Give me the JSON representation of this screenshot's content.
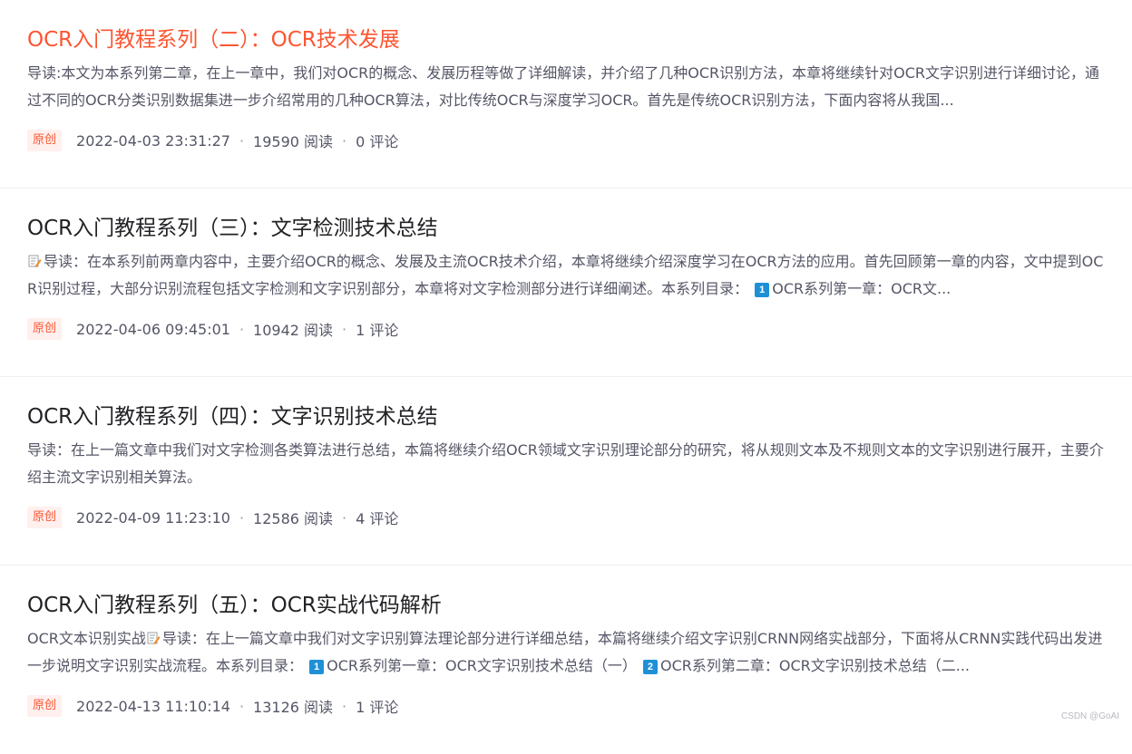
{
  "articles": [
    {
      "title": "OCR入门教程系列（二）：OCR技术发展",
      "summary_prefix": "",
      "summary": "导读:本文为本系列第二章，在上一章中，我们对OCR的概念、发展历程等做了详细解读，并介绍了几种OCR识别方法，本章将继续针对OCR文字识别进行详细讨论，通过不同的OCR分类识别数据集进一步介绍常用的几种OCR算法，对比传统OCR与深度学习OCR。首先是传统OCR识别方法，下面内容将从我国...",
      "tag": "原创",
      "date": "2022-04-03 23:31:27",
      "reads": "19590 阅读",
      "comments": "0 评论"
    },
    {
      "title": "OCR入门教程系列（三）：文字检测技术总结",
      "summary": "导读：在本系列前两章内容中，主要介绍OCR的概念、发展及主流OCR技术介绍，本章将继续介绍深度学习在OCR方法的应用。首先回顾第一章的内容，文中提到OCR识别过程，大部分识别流程包括文字检测和文字识别部分，本章将对文字检测部分进行详细阐述。本系列目录：",
      "summary_badge": "1",
      "summary_tail": "OCR系列第一章：OCR文...",
      "tag": "原创",
      "date": "2022-04-06 09:45:01",
      "reads": "10942 阅读",
      "comments": "1 评论"
    },
    {
      "title": "OCR入门教程系列（四）：文字识别技术总结",
      "summary": "导读：在上一篇文章中我们对文字检测各类算法进行总结，本篇将继续介绍OCR领域文字识别理论部分的研究，将从规则文本及不规则文本的文字识别进行展开，主要介绍主流文字识别相关算法。",
      "tag": "原创",
      "date": "2022-04-09 11:23:10",
      "reads": "12586 阅读",
      "comments": "4 评论"
    },
    {
      "title": "OCR入门教程系列（五）：OCR实战代码解析",
      "summary_prefix": "OCR文本识别实战",
      "summary": "导读：在上一篇文章中我们对文字识别算法理论部分进行详细总结，本篇将继续介绍文字识别CRNN网络实战部分，下面将从CRNN实践代码出发进一步说明文字识别实战流程。本系列目录：",
      "summary_badge": "1",
      "summary_mid": "OCR系列第一章：OCR文字识别技术总结（一）",
      "summary_badge2": "2",
      "summary_tail": "OCR系列第二章：OCR文字识别技术总结（二...",
      "tag": "原创",
      "date": "2022-04-13 11:10:14",
      "reads": "13126 阅读",
      "comments": "1 评论"
    }
  ],
  "meta_separator": "·",
  "watermark": "CSDN @GoAI",
  "colors": {
    "accent": "#fc5531",
    "text": "#222226",
    "muted": "#555666",
    "badge": "#1e90d6"
  },
  "icons": {
    "memo": "memo-icon",
    "number_badge": "keycap-number-icon"
  }
}
